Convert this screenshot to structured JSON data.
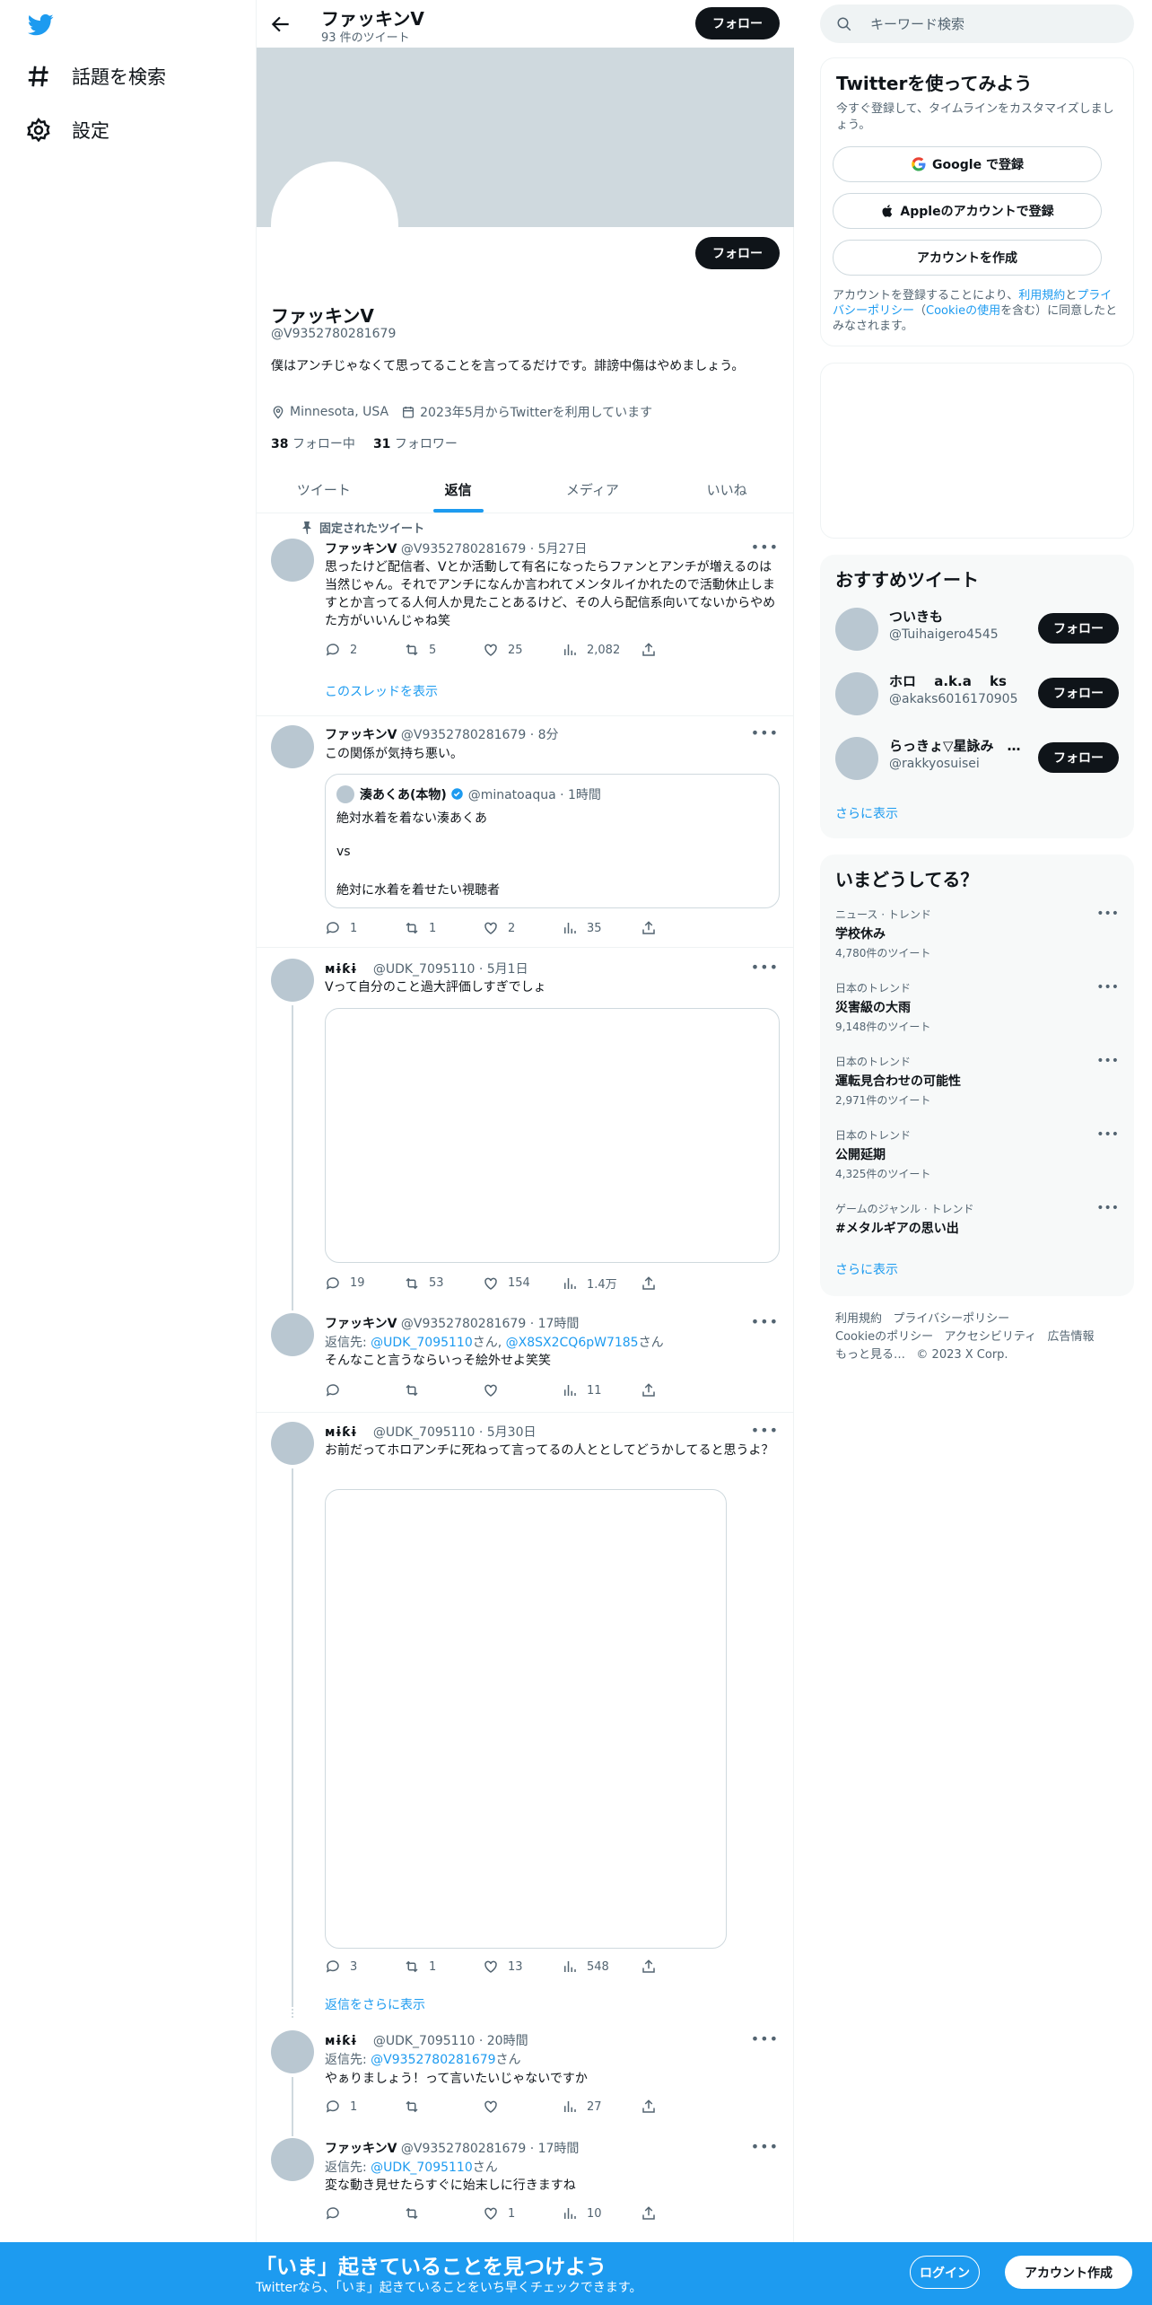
{
  "nav": {
    "logo": "twitter-bird-icon",
    "explore": "話題を検索",
    "settings": "設定"
  },
  "header": {
    "name": "ファッキンV",
    "count": "93 件のツイート",
    "follow": "フォロー"
  },
  "profile": {
    "follow": "フォロー",
    "name": "ファッキンV",
    "handle": "@V9352780281679",
    "bio": "僕はアンチじゃなくて思ってることを言ってるだけです。誹謗中傷はやめましょう。",
    "location": "Minnesota, USA",
    "joined": "2023年5月からTwitterを利用しています",
    "following_count": "38",
    "following_label": "フォロー中",
    "followers_count": "31",
    "followers_label": "フォロワー"
  },
  "tabs": [
    "ツイート",
    "返信",
    "メディア",
    "いいね"
  ],
  "pinned_label": "固定されたツイート",
  "tweets": [
    {
      "name": "ファッキンV",
      "meta": "@V9352780281679 · 5月27日",
      "text": "思ったけど配信者、Vとか活動して有名になったらファンとアンチが増えるのは当然じゃん。それでアンチになんか言われてメンタルイかれたので活動休止しますとか言ってる人何人か見たことあるけど、その人ら配信系向いてないからやめた方がいいんじゃね笑",
      "reply": "2",
      "rt": "5",
      "like": "25",
      "views": "2,082",
      "thread": "このスレッドを表示"
    },
    {
      "name": "ファッキンV",
      "meta": "@V9352780281679 · 8分",
      "text": "この関係が気持ち悪い。",
      "quote_name": "湊あくあ(本物)",
      "quote_meta": "@minatoaqua · 1時間",
      "quote_l1": "絶対水着を着ない湊あくあ",
      "quote_l2": "vs",
      "quote_l3": "絶対に水着を着せたい視聴者",
      "reply": "1",
      "rt": "1",
      "like": "2",
      "views": "35"
    },
    {
      "name": "ᴍɨƙɨ",
      "meta": "@UDK_7095110 · 5月1日",
      "text": "Vって自分のこと過大評価しすぎでしょ",
      "reply": "19",
      "rt": "53",
      "like": "154",
      "views": "1.4万"
    },
    {
      "name": "ファッキンV",
      "meta": "@V9352780281679 · 17時間",
      "reply_prefix": "返信先: ",
      "reply_to1": "@UDK_7095110",
      "reply_san1": "さん, ",
      "reply_to2": "@X8SX2CQ6pW7185",
      "reply_san2": "さん",
      "text": "そんなこと言うならいっそ絵外せよ笑笑",
      "reply": "",
      "rt": "",
      "like": "",
      "views": "11"
    },
    {
      "name": "ᴍɨƙɨ",
      "meta": "@UDK_7095110 · 5月30日",
      "text": "お前だってホロアンチに死ねって言ってるの人ととしてどうかしてると思うよ？",
      "reply": "3",
      "rt": "1",
      "like": "13",
      "views": "548",
      "more_replies": "返信をさらに表示"
    },
    {
      "name": "ᴍɨƙɨ",
      "meta": "@UDK_7095110 · 20時間",
      "reply_prefix": "返信先: ",
      "reply_to1": "@V9352780281679",
      "reply_san1": "さん",
      "text": "やぁりましょう！って言いたいじゃないですか",
      "reply": "1",
      "rt": "",
      "like": "",
      "views": "27"
    },
    {
      "name": "ファッキンV",
      "meta": "@V9352780281679 · 17時間",
      "reply_prefix": "返信先: ",
      "reply_to1": "@UDK_7095110",
      "reply_san1": "さん",
      "text": "変な動き見せたらすぐに始末しに行きますね",
      "reply": "",
      "rt": "",
      "like": "1",
      "views": "10"
    }
  ],
  "right": {
    "search_placeholder": "キーワード検索",
    "signup_title": "Twitterを使ってみよう",
    "signup_desc": "今すぐ登録して、タイムラインをカスタマイズしましょう。",
    "google_btn": "Google で登録",
    "apple_btn": "Appleのアカウントで登録",
    "create_btn": "アカウントを作成",
    "terms_pre": "アカウントを登録することにより、",
    "terms_link": "利用規約",
    "terms_mid": "と",
    "privacy_link": "プライバシーポリシー",
    "cookie_pre": "（",
    "cookie_link": "Cookieの使用",
    "terms_post": "を含む）に同意したとみなされます。",
    "rec_title": "おすすめツイート",
    "recs": [
      {
        "name": "ついきも",
        "handle": "@Tuihaigero4545",
        "btn": "フォロー"
      },
      {
        "name": "ホロ　 a.k.a　 ks",
        "handle": "@akaks6016170905",
        "btn": "フォロー"
      },
      {
        "name": "らっきょ▽星詠み　…",
        "handle": "@rakkyosuisei",
        "btn": "フォロー"
      }
    ],
    "show_more": "さらに表示",
    "trend_title": "いまどうしてる？",
    "trends": [
      {
        "cat": "ニュース · トレンド",
        "name": "学校休み",
        "count": "4,780件のツイート"
      },
      {
        "cat": "日本のトレンド",
        "name": "災害級の大雨",
        "count": "9,148件のツイート"
      },
      {
        "cat": "日本のトレンド",
        "name": "運転見合わせの可能性",
        "count": "2,971件のツイート"
      },
      {
        "cat": "日本のトレンド",
        "name": "公開延期",
        "count": "4,325件のツイート"
      },
      {
        "cat": "ゲームのジャンル · トレンド",
        "name": "#メタルギアの思い出",
        "count": ""
      }
    ],
    "trend_more": "さらに表示",
    "footer": [
      "利用規約",
      "プライバシーポリシー",
      "Cookieのポリシー",
      "アクセシビリティ",
      "広告情報",
      "もっと見る…",
      "© 2023 X Corp."
    ]
  },
  "bottom": {
    "title": "「いま」起きていることを見つけよう",
    "sub": "Twitterなら、「いま」起きていることをいち早くチェックできます。",
    "login": "ログイン",
    "signup": "アカウント作成"
  },
  "colors": {
    "accent": "#1d9bf0",
    "text": "#0f1419",
    "muted": "#536471",
    "banner": "#cfd9de"
  }
}
